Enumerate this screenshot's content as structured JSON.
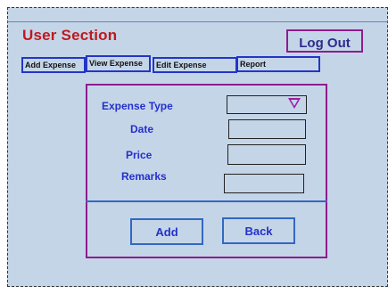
{
  "header": {
    "title": "User Section",
    "logout_label": "Log Out"
  },
  "tabs": [
    {
      "label": "Add Expense"
    },
    {
      "label": "View Expense"
    },
    {
      "label": "Edit Expense"
    },
    {
      "label": "Report"
    }
  ],
  "form": {
    "expense_type_label": "Expense Type",
    "date_label": "Date",
    "price_label": "Price",
    "remarks_label": "Remarks",
    "expense_type_value": "",
    "date_value": "",
    "price_value": "",
    "remarks_value": ""
  },
  "actions": {
    "add_label": "Add",
    "back_label": "Back"
  },
  "colors": {
    "background": "#c5d5e8",
    "title": "#c0191c",
    "label": "#2330cc",
    "panel_border": "#8d1d8d",
    "tab_border": "#2236c8"
  }
}
